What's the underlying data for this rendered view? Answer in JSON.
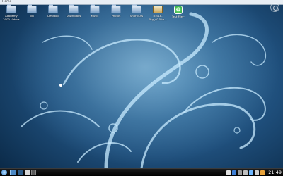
{
  "topbar": {
    "title": "Home"
  },
  "desktop_icons": [
    {
      "label": "Academy 2000 Videos",
      "icon": "folder-icon"
    },
    {
      "label": "bin",
      "icon": "folder-icon"
    },
    {
      "label": "Desktop",
      "icon": "folder-icon"
    },
    {
      "label": "Downloads",
      "icon": "folder-icon"
    },
    {
      "label": "Music",
      "icon": "folder-icon"
    },
    {
      "label": "Photos",
      "icon": "folder-icon"
    },
    {
      "label": "Shortcuts",
      "icon": "folder-icon"
    },
    {
      "label": "RTSLE-Pkg_v0.5.ta...",
      "icon": "archive-icon"
    },
    {
      "label": "Test File~",
      "icon": "trash-icon"
    }
  ],
  "panel": {
    "clock": "21:49"
  },
  "colors": {
    "panel": "#000000",
    "accent": "#2f7fd0"
  }
}
